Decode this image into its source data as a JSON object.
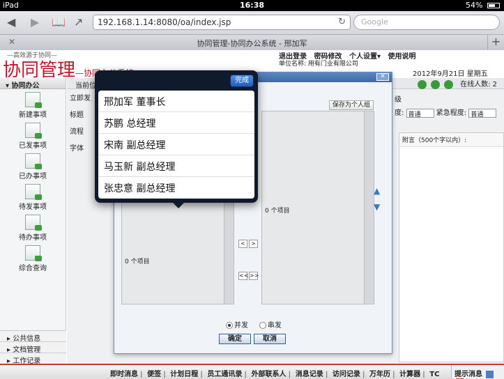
{
  "status": {
    "device": "iPad",
    "time": "16:38",
    "battery": "54%"
  },
  "browser": {
    "url": "192.168.1.14:8080/oa/index.jsp",
    "search_placeholder": "Google",
    "tab_title": "协同管理-协同办公系统 - 邢加军"
  },
  "oa_header": {
    "slogan": "—高效源于协同—",
    "logo": "协同管理",
    "logo_sub": "—协同办公系统",
    "menu": [
      "退出登录",
      "密码修改",
      "个人设置▾",
      "使用说明"
    ],
    "unit": "单位名称: 用有门业有限公司",
    "date": "2012年9月21日 星期五"
  },
  "sidebar": {
    "title": "协同办公",
    "items": [
      "新建事项",
      "已发事项",
      "已办事项",
      "待发事项",
      "待办事项",
      "综合查询"
    ],
    "bottom": [
      "公共信息",
      "文档管理",
      "工作记录"
    ]
  },
  "main": {
    "breadcrumb": "当前位",
    "online": "在线人数: 2",
    "left_stubs": [
      "立即发",
      "标题",
      "流程",
      "字体"
    ],
    "importance_label": "度:",
    "urgency_label": "紧急程度:",
    "importance_value": "普通",
    "urgency_value": "普通",
    "right_level": "级",
    "attachment_head": "附言（500个字以内）:"
  },
  "dialog": {
    "save_group": "保存为个人组",
    "left_count": "0 个项目",
    "right_count": "0 个项目",
    "radio_parallel": "并发",
    "radio_serial": "串发",
    "ok": "确定",
    "cancel": "取消"
  },
  "popover": {
    "done": "完成",
    "items": [
      "邢加军 董事长",
      "苏鹏 总经理",
      "宋南 副总经理",
      "马玉新 副总经理",
      "张忠意 副总经理"
    ]
  },
  "bottombar": {
    "links": [
      "即时消息",
      "便签",
      "计划日程",
      "员工通讯录",
      "外部联系人",
      "消息记录",
      "访问记录",
      "万年历",
      "计算器",
      "TC"
    ],
    "hint": "提示消息"
  }
}
